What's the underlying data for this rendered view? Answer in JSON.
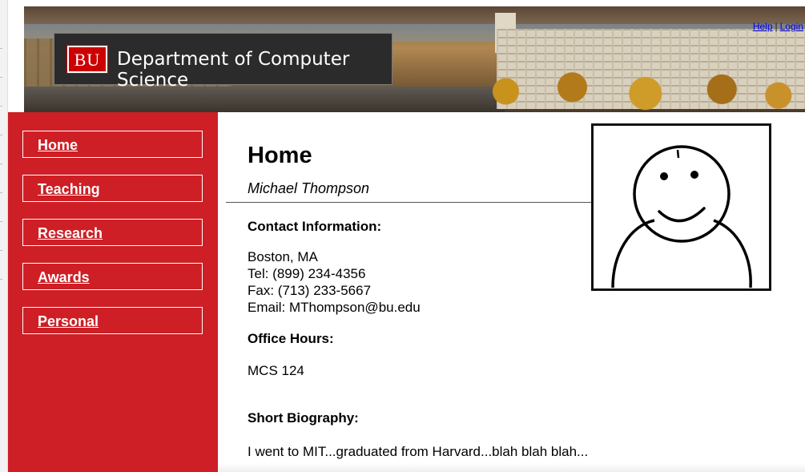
{
  "header": {
    "logo_text": "BU",
    "department": "Department of Computer Science",
    "links": {
      "help": "Help",
      "separator": "|",
      "login": "Login"
    }
  },
  "sidebar": {
    "items": [
      {
        "label": "Home"
      },
      {
        "label": "Teaching"
      },
      {
        "label": "Research"
      },
      {
        "label": "Awards"
      },
      {
        "label": "Personal"
      }
    ]
  },
  "main": {
    "title": "Home",
    "name": "Michael Thompson",
    "contact": {
      "heading": "Contact Information:",
      "location": "Boston, MA",
      "tel": "Tel: (899) 234-4356",
      "fax": "Fax: (713) 233-5667",
      "email": "Email: MThompson@bu.edu"
    },
    "office": {
      "heading": "Office Hours:",
      "value": "MCS 124"
    },
    "bio": {
      "heading": "Short Biography:",
      "text": "I went to MIT...graduated from Harvard...blah blah blah..."
    }
  },
  "colors": {
    "brand_red": "#cd1f25",
    "link_blue": "#0000ee",
    "logo_box": "#2b2b2b"
  },
  "icons": {
    "profile": "smiley-face-avatar-icon"
  }
}
